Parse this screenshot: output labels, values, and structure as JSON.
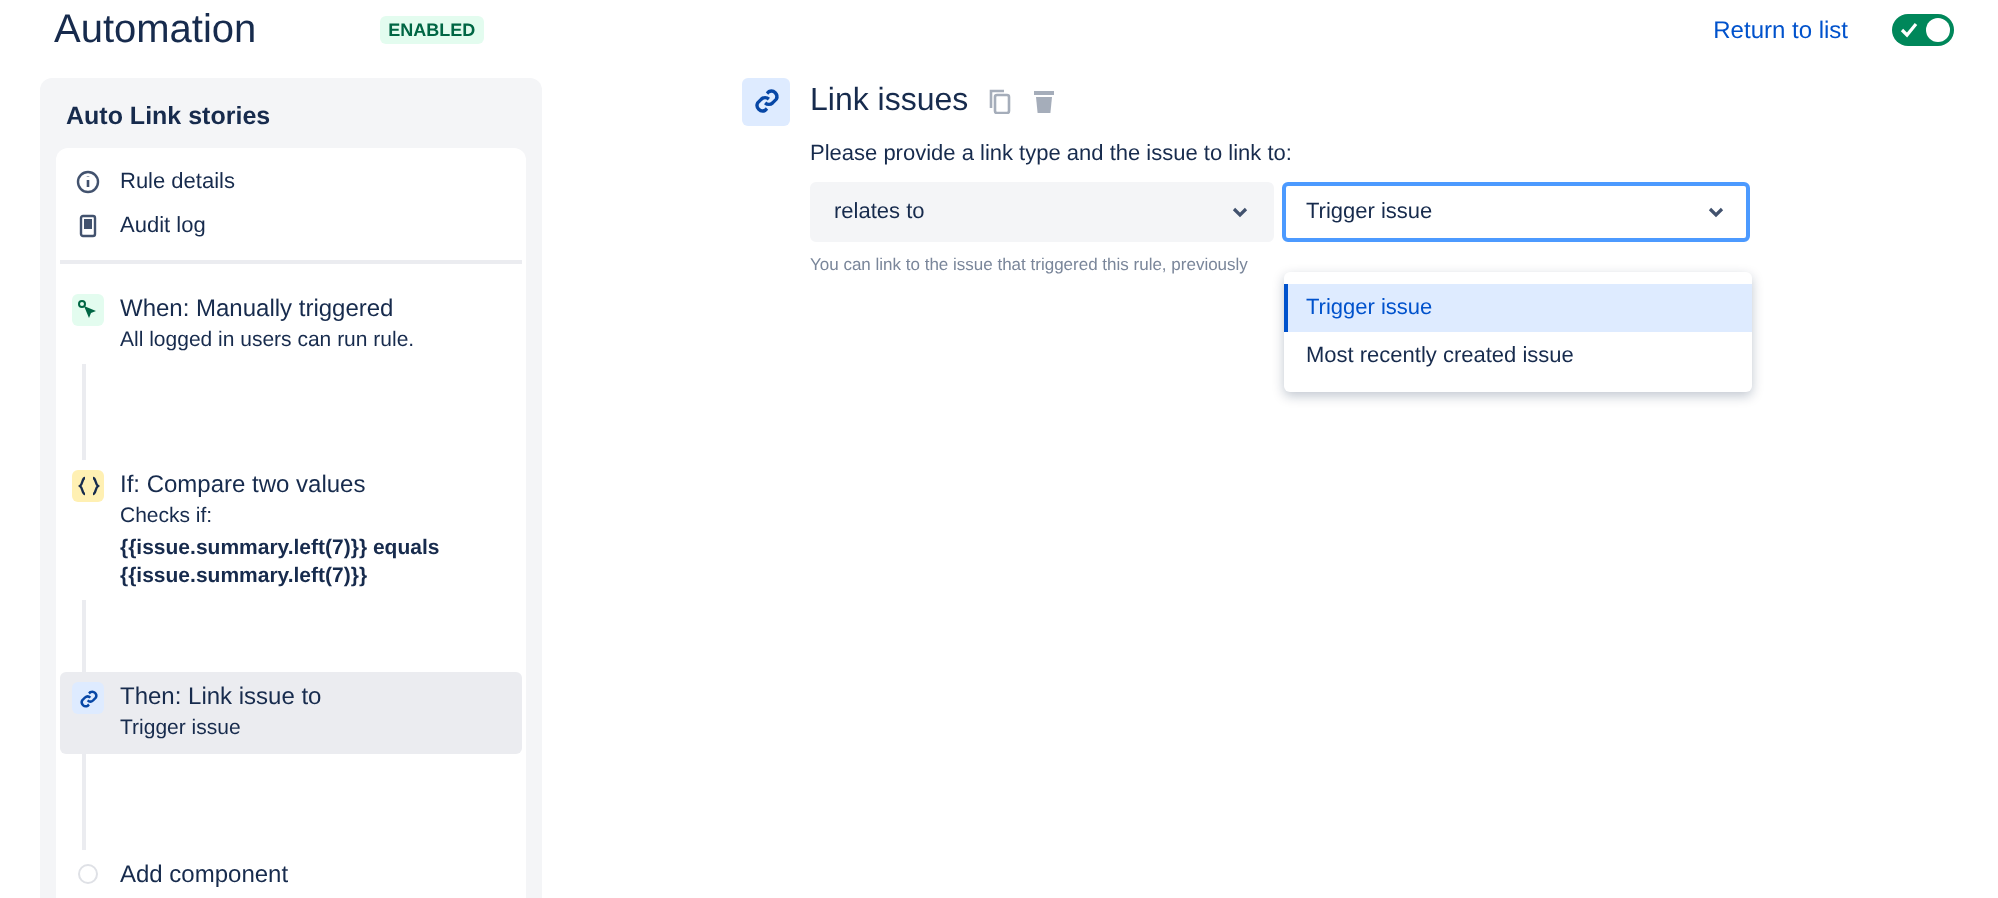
{
  "header": {
    "title": "Automation",
    "status": "ENABLED",
    "return_link": "Return to list",
    "toggle_on": true
  },
  "sidebar": {
    "rule_name": "Auto Link stories",
    "menu": [
      {
        "kind": "info",
        "label": "Rule details"
      },
      {
        "kind": "log",
        "label": "Audit log"
      }
    ],
    "steps": [
      {
        "kind": "trigger",
        "title": "When: Manually triggered",
        "detail": "All logged in users can run rule.",
        "selected": false
      },
      {
        "kind": "condition",
        "title": "If: Compare two values",
        "detail": "Checks if:",
        "expression": "**{{issue.summary.left(7)}} equals {{issue.summary.left(7)}}**",
        "selected": false
      },
      {
        "kind": "action",
        "title": "Then: Link issue to",
        "detail": "Trigger issue",
        "selected": true
      },
      {
        "kind": "add",
        "title": "Add component",
        "selected": false
      }
    ]
  },
  "editor": {
    "title": "Link issues",
    "prompt": "Please provide a link type and the issue to link to:",
    "link_type": "relates to",
    "target": "Trigger issue",
    "hint": "You can link to the issue that triggered this rule, previously",
    "options": [
      {
        "label": "Trigger issue",
        "selected": true
      },
      {
        "label": "Most recently created issue",
        "selected": false
      }
    ]
  }
}
